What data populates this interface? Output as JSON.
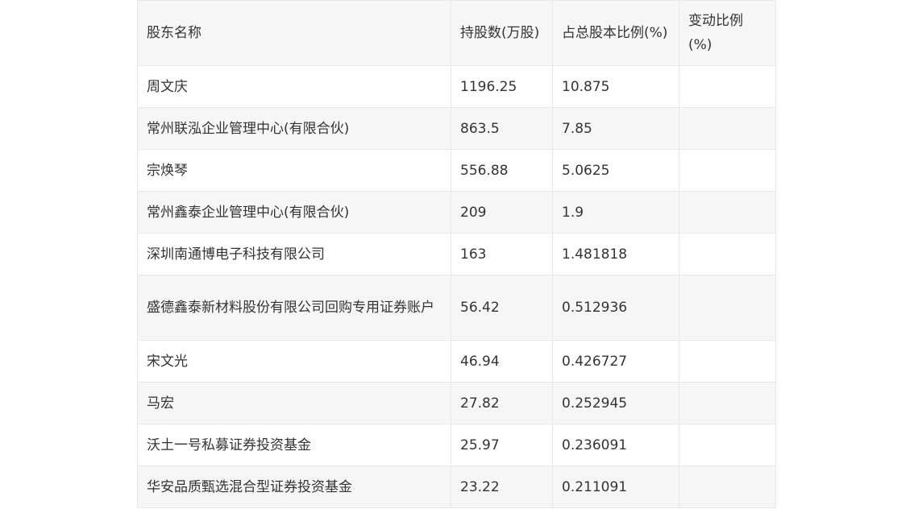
{
  "table": {
    "headers": [
      "股东名称",
      "持股数(万股)",
      "占总股本比例(%)",
      "变动比例(%)"
    ],
    "rows": [
      [
        "周文庆",
        "1196.25",
        "10.875",
        ""
      ],
      [
        "常州联泓企业管理中心(有限合伙)",
        "863.5",
        "7.85",
        ""
      ],
      [
        "宗焕琴",
        "556.88",
        "5.0625",
        ""
      ],
      [
        "常州鑫泰企业管理中心(有限合伙)",
        "209",
        "1.9",
        ""
      ],
      [
        "深圳南通博电子科技有限公司",
        "163",
        "1.481818",
        ""
      ],
      [
        "盛德鑫泰新材料股份有限公司回购专用证券账户",
        "56.42",
        "0.512936",
        ""
      ],
      [
        "宋文光",
        "46.94",
        "0.426727",
        ""
      ],
      [
        "马宏",
        "27.82",
        "0.252945",
        ""
      ],
      [
        "沃土一号私募证券投资基金",
        "25.97",
        "0.236091",
        ""
      ],
      [
        "华安品质甄选混合型证券投资基金",
        "23.22",
        "0.211091",
        ""
      ]
    ]
  }
}
